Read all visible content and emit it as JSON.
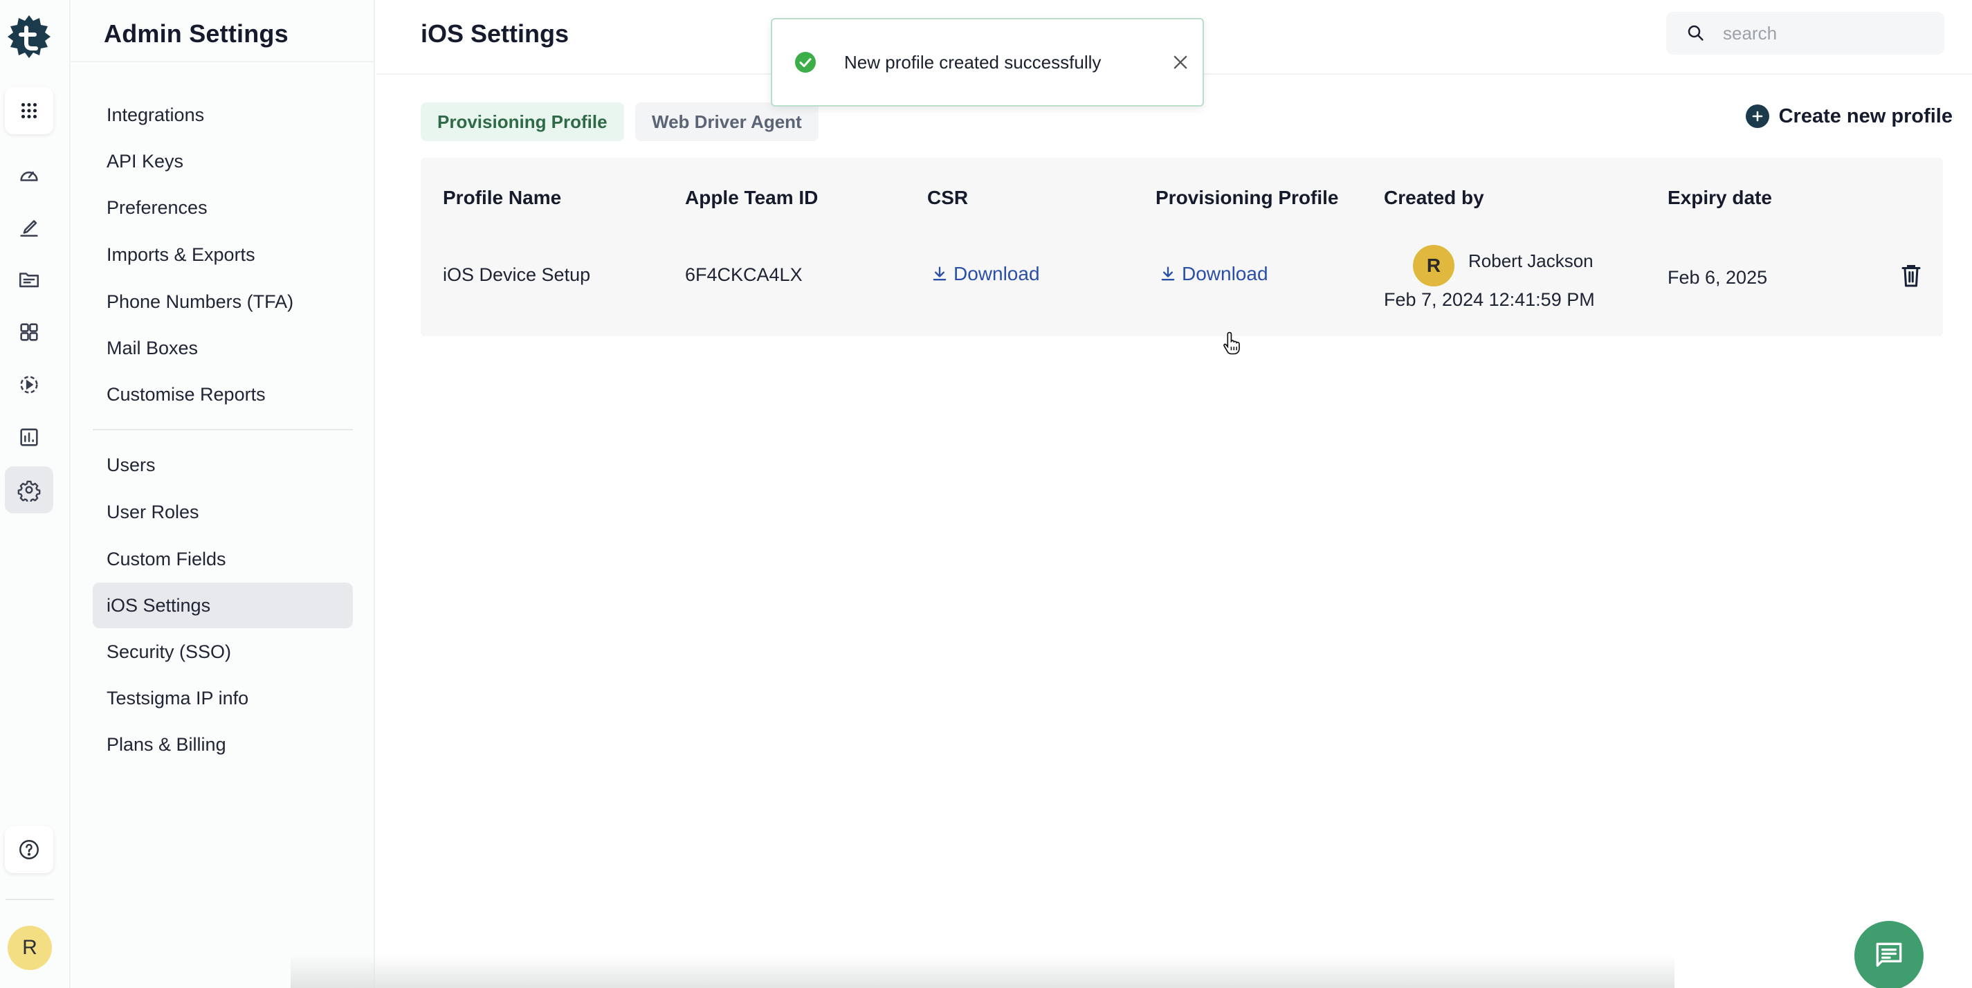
{
  "app": {
    "brand_color": "#1b3a4b",
    "accent_green": "#3f9d6e"
  },
  "rail": {
    "items": [
      {
        "icon": "apps-grid-icon",
        "label": "Apps"
      },
      {
        "icon": "dashboard-gauge-icon",
        "label": "Dashboard"
      },
      {
        "icon": "edit-pencil-icon",
        "label": "Test Development"
      },
      {
        "icon": "folder-icon",
        "label": "Test Data"
      },
      {
        "icon": "modules-grid-icon",
        "label": "Add-ons"
      },
      {
        "icon": "run-play-icon",
        "label": "Run"
      },
      {
        "icon": "reports-chart-icon",
        "label": "Reports"
      },
      {
        "icon": "settings-gear-icon",
        "label": "Settings"
      }
    ],
    "help_icon": "help-circle-icon",
    "user_initial": "R"
  },
  "settings_nav": {
    "title": "Admin Settings",
    "group1": [
      "Integrations",
      "API Keys",
      "Preferences",
      "Imports & Exports",
      "Phone Numbers (TFA)",
      "Mail Boxes",
      "Customise Reports"
    ],
    "group2": [
      "Users",
      "User Roles",
      "Custom Fields",
      "iOS Settings",
      "Security (SSO)",
      "Testsigma IP info",
      "Plans & Billing"
    ],
    "active": "iOS Settings"
  },
  "header": {
    "title": "iOS Settings",
    "search_placeholder": "search"
  },
  "tabs": [
    {
      "label": "Provisioning Profile",
      "active": true
    },
    {
      "label": "Web Driver Agent",
      "active": false
    }
  ],
  "actions": {
    "create_label": "Create new profile"
  },
  "table": {
    "columns": [
      "Profile Name",
      "Apple Team ID",
      "CSR",
      "Provisioning Profile",
      "Created by",
      "Expiry date"
    ],
    "rows": [
      {
        "profile_name": "iOS Device Setup",
        "apple_team_id": "6F4CKCA4LX",
        "csr": "Download",
        "provisioning_profile": "Download",
        "created_by": {
          "initial": "R",
          "name": "Robert Jackson",
          "created_at": "Feb 7, 2024 12:41:59 PM"
        },
        "expiry_date": "Feb 6, 2025"
      }
    ]
  },
  "toast": {
    "type": "success",
    "message": "New profile created successfully"
  }
}
